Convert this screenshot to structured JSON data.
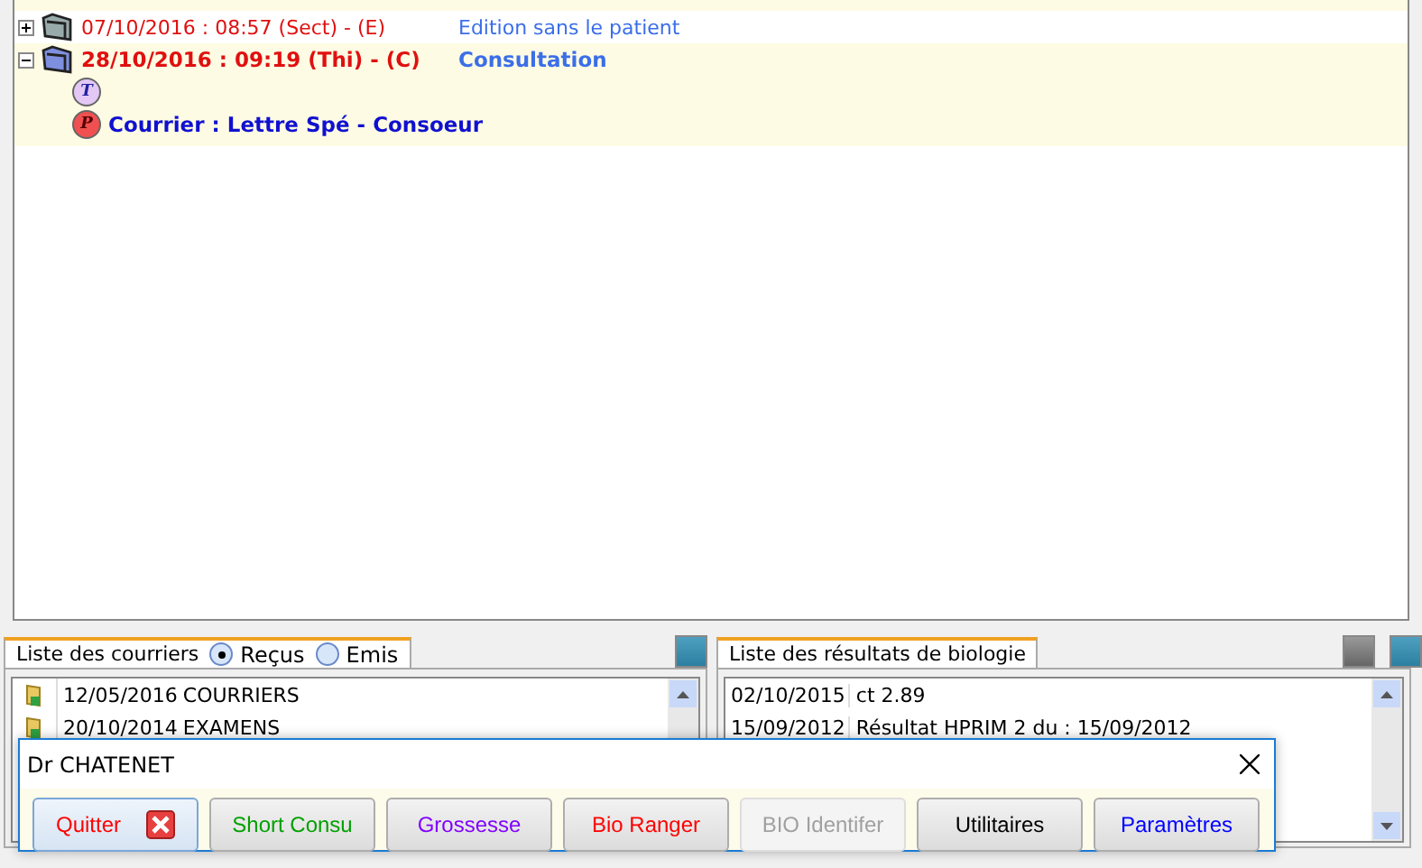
{
  "tree": [
    {
      "label": "07/10/2016 : 08:57 (Sect) - (E)",
      "note": "Edition sans le patient",
      "expanded": false,
      "bold": false
    },
    {
      "label": "28/10/2016 : 09:19 (Thi) - (C)",
      "note": "Consultation",
      "expanded": true,
      "bold": true,
      "children": [
        {
          "kind": "t",
          "badge": "T"
        },
        {
          "kind": "p",
          "badge": "P",
          "label": "Courrier : Lettre Spé - Consoeur"
        }
      ]
    }
  ],
  "courriers": {
    "tab": "Liste des courriers",
    "filters": [
      {
        "label": "Reçus",
        "selected": true
      },
      {
        "label": "Emis",
        "selected": false
      }
    ],
    "rows": [
      {
        "date": "12/05/2016",
        "label": "COURRIERS"
      },
      {
        "date": "20/10/2014",
        "label": "EXAMENS"
      }
    ]
  },
  "biologie": {
    "tab": "Liste des résultats de biologie",
    "rows": [
      {
        "date": "02/10/2015",
        "label": "ct 2.89"
      },
      {
        "date": "15/09/2012",
        "label": "Résultat HPRIM 2  du : 15/09/2012"
      }
    ]
  },
  "dialog": {
    "title": "Dr CHATENET",
    "buttons": [
      {
        "label": "Quitter",
        "color": "#ff0000",
        "disabled": false,
        "kind": "close"
      },
      {
        "label": "Short Consu",
        "color": "#00a000",
        "disabled": false,
        "kind": "plain"
      },
      {
        "label": "Grossesse",
        "color": "#8000ff",
        "disabled": false,
        "kind": "plain"
      },
      {
        "label": "Bio Ranger",
        "color": "#ff0000",
        "disabled": false,
        "kind": "plain"
      },
      {
        "label": "BIO Identifer",
        "color": "#a0a0a0",
        "disabled": true,
        "kind": "plain"
      },
      {
        "label": "Utilitaires",
        "color": "#000000",
        "disabled": false,
        "kind": "plain"
      },
      {
        "label": "Paramètres",
        "color": "#0000ff",
        "disabled": false,
        "kind": "plain"
      }
    ]
  }
}
